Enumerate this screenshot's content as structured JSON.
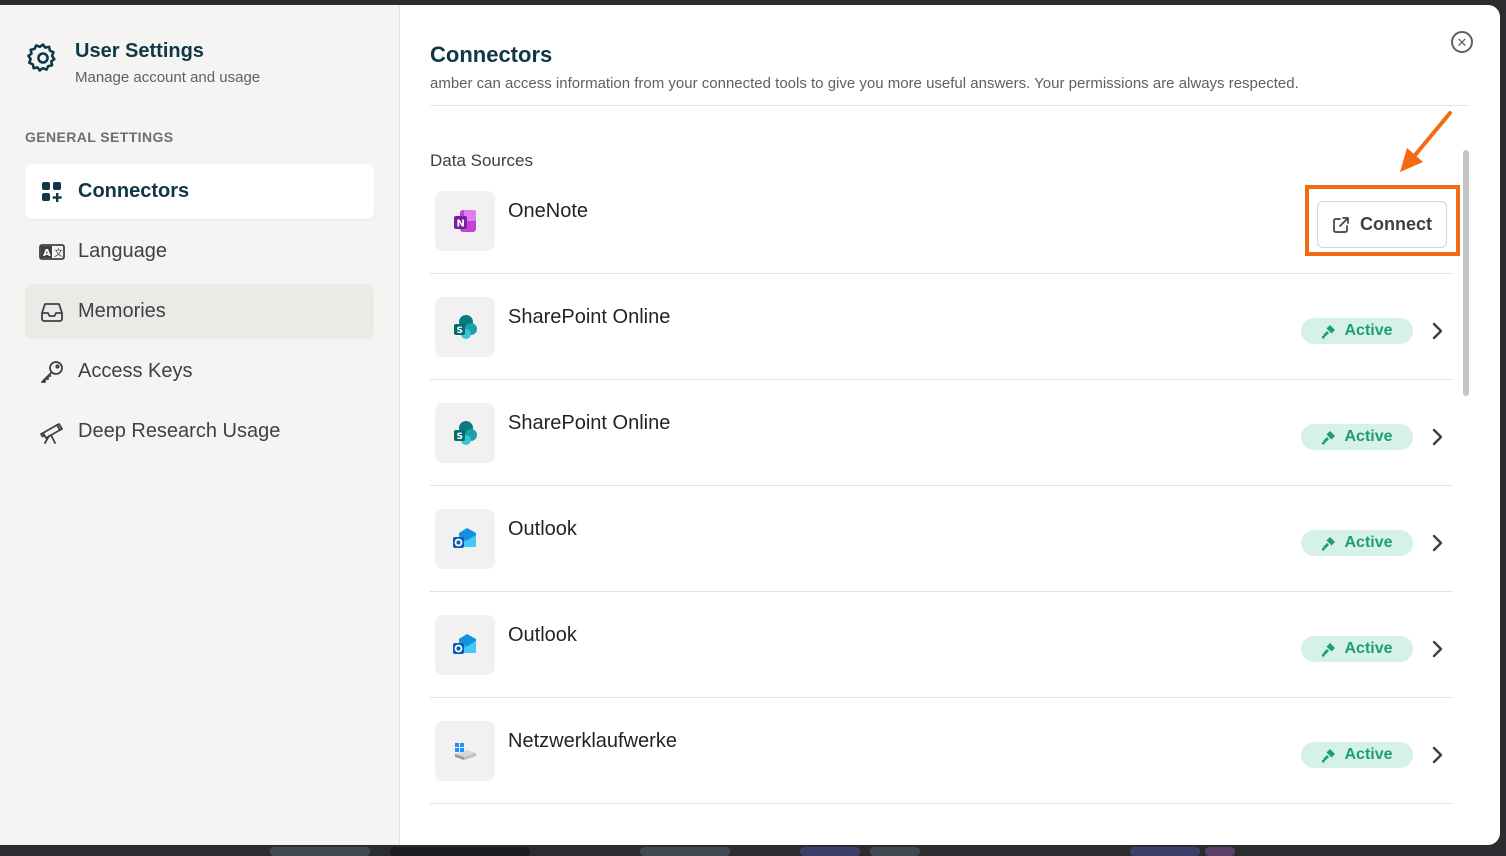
{
  "sidebar": {
    "title": "User Settings",
    "subtitle": "Manage account and usage",
    "section": "GENERAL SETTINGS",
    "items": [
      {
        "label": "Connectors",
        "icon": "grid-plus-icon"
      },
      {
        "label": "Language",
        "icon": "language-icon"
      },
      {
        "label": "Memories",
        "icon": "inbox-icon"
      },
      {
        "label": "Access Keys",
        "icon": "key-icon"
      },
      {
        "label": "Deep Research Usage",
        "icon": "telescope-icon"
      }
    ]
  },
  "main": {
    "title": "Connectors",
    "description": "amber can access information from your connected tools to give you more useful answers. Your permissions are always respected.",
    "section_label": "Data Sources",
    "connect_label": "Connect",
    "active_label": "Active",
    "connectors": [
      {
        "name": "OneNote",
        "status": "connect",
        "icon": "onenote-icon"
      },
      {
        "name": "SharePoint Online",
        "status": "active",
        "icon": "sharepoint-icon"
      },
      {
        "name": "SharePoint Online",
        "status": "active",
        "icon": "sharepoint-icon"
      },
      {
        "name": "Outlook",
        "status": "active",
        "icon": "outlook-icon"
      },
      {
        "name": "Outlook",
        "status": "active",
        "icon": "outlook-icon"
      },
      {
        "name": "Netzwerklaufwerke",
        "status": "active",
        "icon": "network-drive-icon"
      }
    ]
  },
  "colors": {
    "accent": "#0f3747",
    "active_bg": "#d6f2e8",
    "active_text": "#1e9e6e",
    "highlight": "#f26a12"
  }
}
